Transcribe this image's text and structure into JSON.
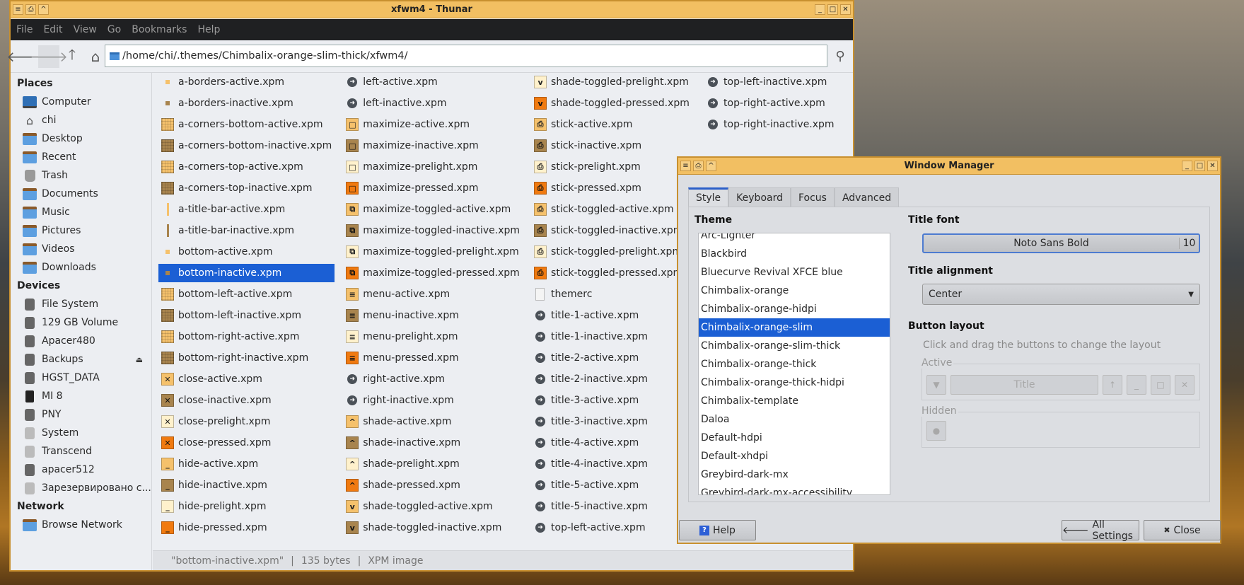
{
  "thunar": {
    "title": "xfwm4 - Thunar",
    "menu": [
      "File",
      "Edit",
      "View",
      "Go",
      "Bookmarks",
      "Help"
    ],
    "path": "/home/chi/.themes/Chimbalix-orange-slim-thick/xfwm4/",
    "sidebar": {
      "places_heading": "Places",
      "places": [
        {
          "label": "Computer",
          "icon": "comp"
        },
        {
          "label": "chi",
          "icon": "home"
        },
        {
          "label": "Desktop",
          "icon": "folder"
        },
        {
          "label": "Recent",
          "icon": "folder"
        },
        {
          "label": "Trash",
          "icon": "trash"
        },
        {
          "label": "Documents",
          "icon": "folder"
        },
        {
          "label": "Music",
          "icon": "folder"
        },
        {
          "label": "Pictures",
          "icon": "folder"
        },
        {
          "label": "Videos",
          "icon": "folder"
        },
        {
          "label": "Downloads",
          "icon": "folder"
        }
      ],
      "devices_heading": "Devices",
      "devices": [
        {
          "label": "File System",
          "icon": "drive"
        },
        {
          "label": "129 GB Volume",
          "icon": "drive"
        },
        {
          "label": "Apacer480",
          "icon": "drive"
        },
        {
          "label": "Backups",
          "icon": "drive",
          "eject": "⏏"
        },
        {
          "label": "HGST_DATA",
          "icon": "drive"
        },
        {
          "label": "MI 8",
          "icon": "phone"
        },
        {
          "label": "PNY",
          "icon": "drive"
        },
        {
          "label": "System",
          "icon": "drive-light"
        },
        {
          "label": "Transcend",
          "icon": "drive-light"
        },
        {
          "label": "apacer512",
          "icon": "drive"
        },
        {
          "label": "Зарезервировано с...",
          "icon": "drive-light"
        }
      ],
      "network_heading": "Network",
      "network": [
        {
          "label": "Browse Network",
          "icon": "folder"
        }
      ]
    },
    "files": [
      "a-borders-active.xpm",
      "a-borders-inactive.xpm",
      "a-corners-bottom-active.xpm",
      "a-corners-bottom-inactive.xpm",
      "a-corners-top-active.xpm",
      "a-corners-top-inactive.xpm",
      "a-title-bar-active.xpm",
      "a-title-bar-inactive.xpm",
      "bottom-active.xpm",
      "bottom-inactive.xpm",
      "bottom-left-active.xpm",
      "bottom-left-inactive.xpm",
      "bottom-right-active.xpm",
      "bottom-right-inactive.xpm",
      "close-active.xpm",
      "close-inactive.xpm",
      "close-prelight.xpm",
      "close-pressed.xpm",
      "hide-active.xpm",
      "hide-inactive.xpm",
      "hide-prelight.xpm",
      "hide-pressed.xpm",
      "left-active.xpm",
      "left-inactive.xpm",
      "maximize-active.xpm",
      "maximize-inactive.xpm",
      "maximize-prelight.xpm",
      "maximize-pressed.xpm",
      "maximize-toggled-active.xpm",
      "maximize-toggled-inactive.xpm",
      "maximize-toggled-prelight.xpm",
      "maximize-toggled-pressed.xpm",
      "menu-active.xpm",
      "menu-inactive.xpm",
      "menu-prelight.xpm",
      "menu-pressed.xpm",
      "right-active.xpm",
      "right-inactive.xpm",
      "shade-active.xpm",
      "shade-inactive.xpm",
      "shade-prelight.xpm",
      "shade-pressed.xpm",
      "shade-toggled-active.xpm",
      "shade-toggled-inactive.xpm",
      "shade-toggled-prelight.xpm",
      "shade-toggled-pressed.xpm",
      "stick-active.xpm",
      "stick-inactive.xpm",
      "stick-prelight.xpm",
      "stick-pressed.xpm",
      "stick-toggled-active.xpm",
      "stick-toggled-inactive.xpm",
      "stick-toggled-prelight.xpm",
      "stick-toggled-pressed.xpm",
      "themerc",
      "title-1-active.xpm",
      "title-1-inactive.xpm",
      "title-2-active.xpm",
      "title-2-inactive.xpm",
      "title-3-active.xpm",
      "title-3-inactive.xpm",
      "title-4-active.xpm",
      "title-4-inactive.xpm",
      "title-5-active.xpm",
      "title-5-inactive.xpm",
      "top-left-active.xpm",
      "top-left-inactive.xpm",
      "top-right-active.xpm",
      "top-right-inactive.xpm"
    ],
    "selected_file": "bottom-inactive.xpm",
    "status": {
      "name": "\"bottom-inactive.xpm\"",
      "size": "135 bytes",
      "type": "XPM image",
      "sep": "|"
    },
    "state_colors": {
      "active": "#f5c16c",
      "inactive": "#a8844e",
      "prelight": "#fff1cc",
      "pressed": "#f07a10"
    }
  },
  "wm": {
    "title": "Window Manager",
    "tabs": [
      "Style",
      "Keyboard",
      "Focus",
      "Advanced"
    ],
    "theme_label": "Theme",
    "themes": [
      "Arc-Lighter",
      "Blackbird",
      "Bluecurve Revival XFCE blue",
      "Chimbalix-orange",
      "Chimbalix-orange-hidpi",
      "Chimbalix-orange-slim",
      "Chimbalix-orange-slim-thick",
      "Chimbalix-orange-thick",
      "Chimbalix-orange-thick-hidpi",
      "Chimbalix-template",
      "Daloa",
      "Default-hdpi",
      "Default-xhdpi",
      "Greybird-dark-mx",
      "Greybird-dark-mx-accessibility"
    ],
    "selected_theme": "Chimbalix-orange-slim",
    "title_font_label": "Title font",
    "title_font": "Noto Sans Bold",
    "title_font_size": "10",
    "title_alignment_label": "Title alignment",
    "title_alignment": "Center",
    "button_layout_label": "Button layout",
    "button_layout_hint": "Click and drag the buttons to change the layout",
    "active_label": "Active",
    "hidden_label": "Hidden",
    "title_button": "Title",
    "help": "Help",
    "all_settings": "All Settings",
    "close": "Close"
  }
}
